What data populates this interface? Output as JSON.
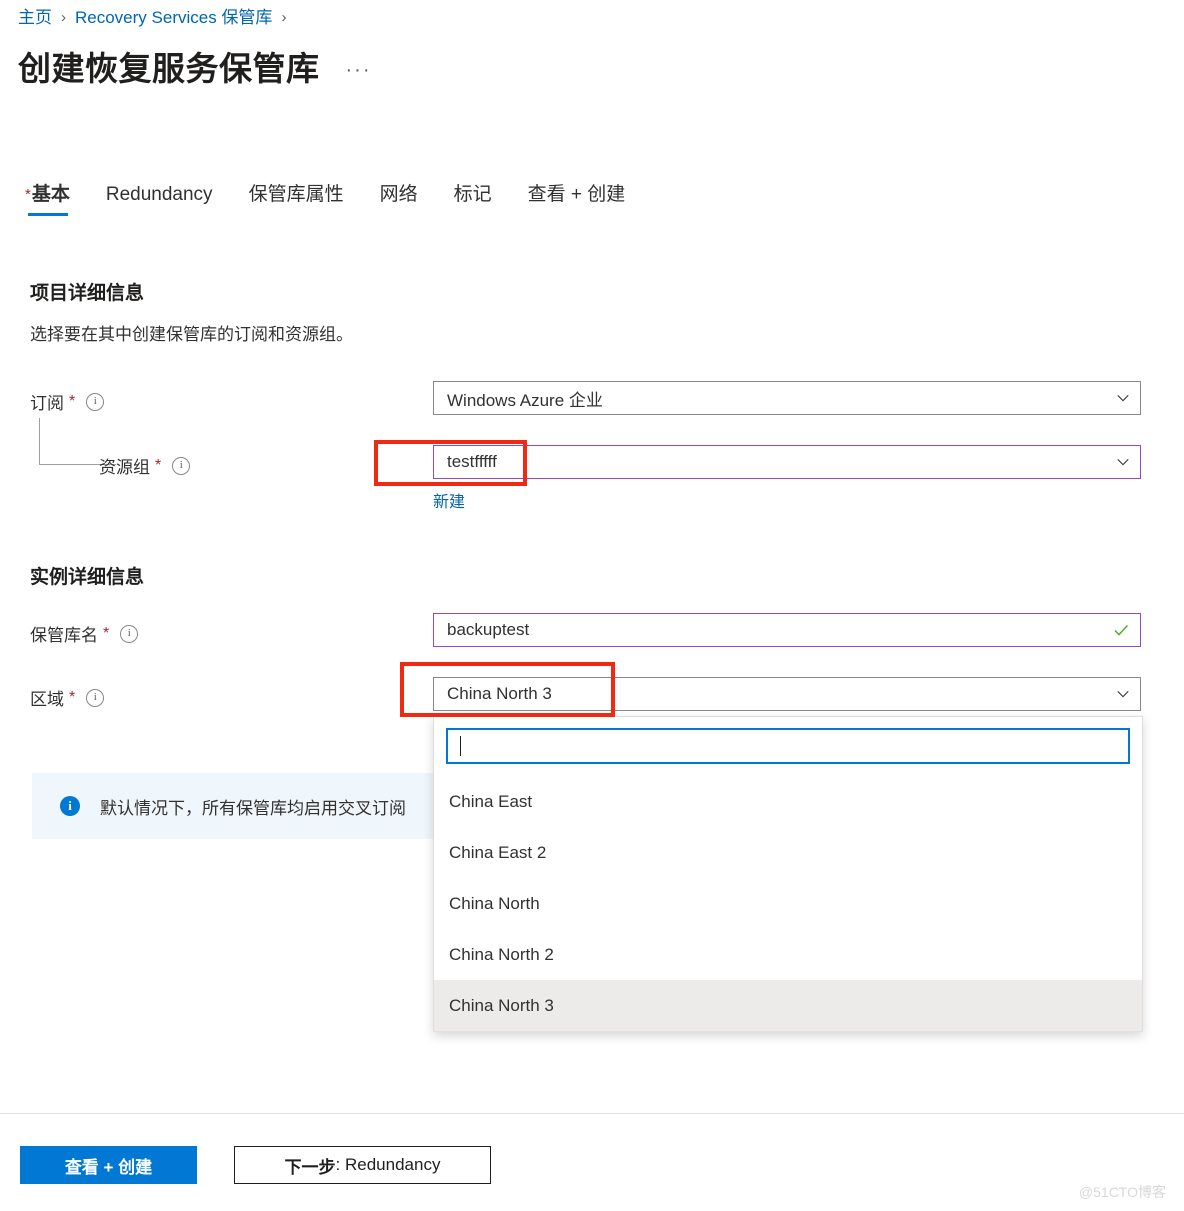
{
  "breadcrumb": {
    "items": [
      {
        "label": "主页"
      },
      {
        "label": "Recovery Services 保管库"
      }
    ],
    "separator": "›"
  },
  "header": {
    "title": "创建恢复服务保管库",
    "more_label": "···"
  },
  "tabs": [
    {
      "label": "基本",
      "required": true,
      "active": true
    },
    {
      "label": "Redundancy",
      "required": false,
      "active": false
    },
    {
      "label": "保管库属性",
      "required": false,
      "active": false
    },
    {
      "label": "网络",
      "required": false,
      "active": false
    },
    {
      "label": "标记",
      "required": false,
      "active": false
    },
    {
      "label": "查看 + 创建",
      "required": false,
      "active": false
    }
  ],
  "project_details": {
    "heading": "项目详细信息",
    "description": "选择要在其中创建保管库的订阅和资源组。",
    "subscription": {
      "label": "订阅",
      "required_star": "*",
      "value": "Windows Azure 企业"
    },
    "resource_group": {
      "label": "资源组",
      "required_star": "*",
      "value": "testfffff",
      "create_new_label": "新建"
    }
  },
  "instance_details": {
    "heading": "实例详细信息",
    "vault_name": {
      "label": "保管库名",
      "required_star": "*",
      "value": "backuptest",
      "valid": true
    },
    "region": {
      "label": "区域",
      "required_star": "*",
      "value": "China North 3"
    }
  },
  "region_dropdown": {
    "search_value": "",
    "options": [
      {
        "label": "China East",
        "selected": false
      },
      {
        "label": "China East 2",
        "selected": false
      },
      {
        "label": "China North",
        "selected": false
      },
      {
        "label": "China North 2",
        "selected": false
      },
      {
        "label": "China North 3",
        "selected": true
      }
    ]
  },
  "info_banner": {
    "icon_glyph": "i",
    "text": "默认情况下，所有保管库均启用交叉订阅"
  },
  "footer": {
    "review_create_label": "查看 + 创建",
    "next_bold": "下一步",
    "next_rest": ": Redundancy"
  },
  "watermark": "@51CTO博客",
  "colors": {
    "accent_blue": "#0078d4",
    "link_blue": "#0065b3",
    "violet_border": "#8f4bbf",
    "annotation_red": "#f02910",
    "required_red": "#a4262c",
    "success_green": "#498205",
    "banner_bg": "#eff6fc",
    "selected_row_bg": "#edebe9"
  }
}
